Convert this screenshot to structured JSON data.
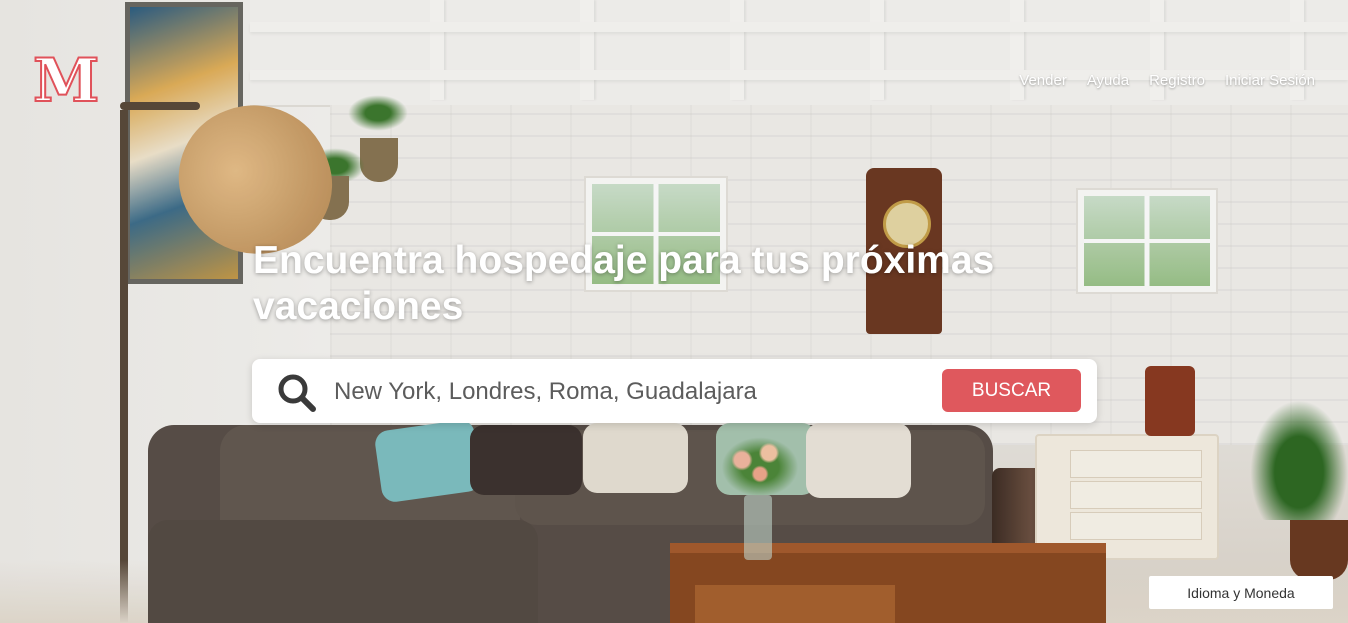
{
  "brand": {
    "logo_letter": "M",
    "accent_color": "#e0525a"
  },
  "nav": {
    "items": [
      {
        "label": "Vender"
      },
      {
        "label": "Ayuda"
      },
      {
        "label": "Registro"
      },
      {
        "label": "Iniciar Sesión"
      }
    ]
  },
  "hero": {
    "headline": "Encuentra hospedaje para tus próximas vacaciones"
  },
  "search": {
    "icon": "search-icon",
    "placeholder": "New York, Londres, Roma, Guadalajara",
    "button_label": "BUSCAR",
    "button_color": "#df585d"
  },
  "footer": {
    "language_currency_label": "Idioma y Moneda"
  }
}
